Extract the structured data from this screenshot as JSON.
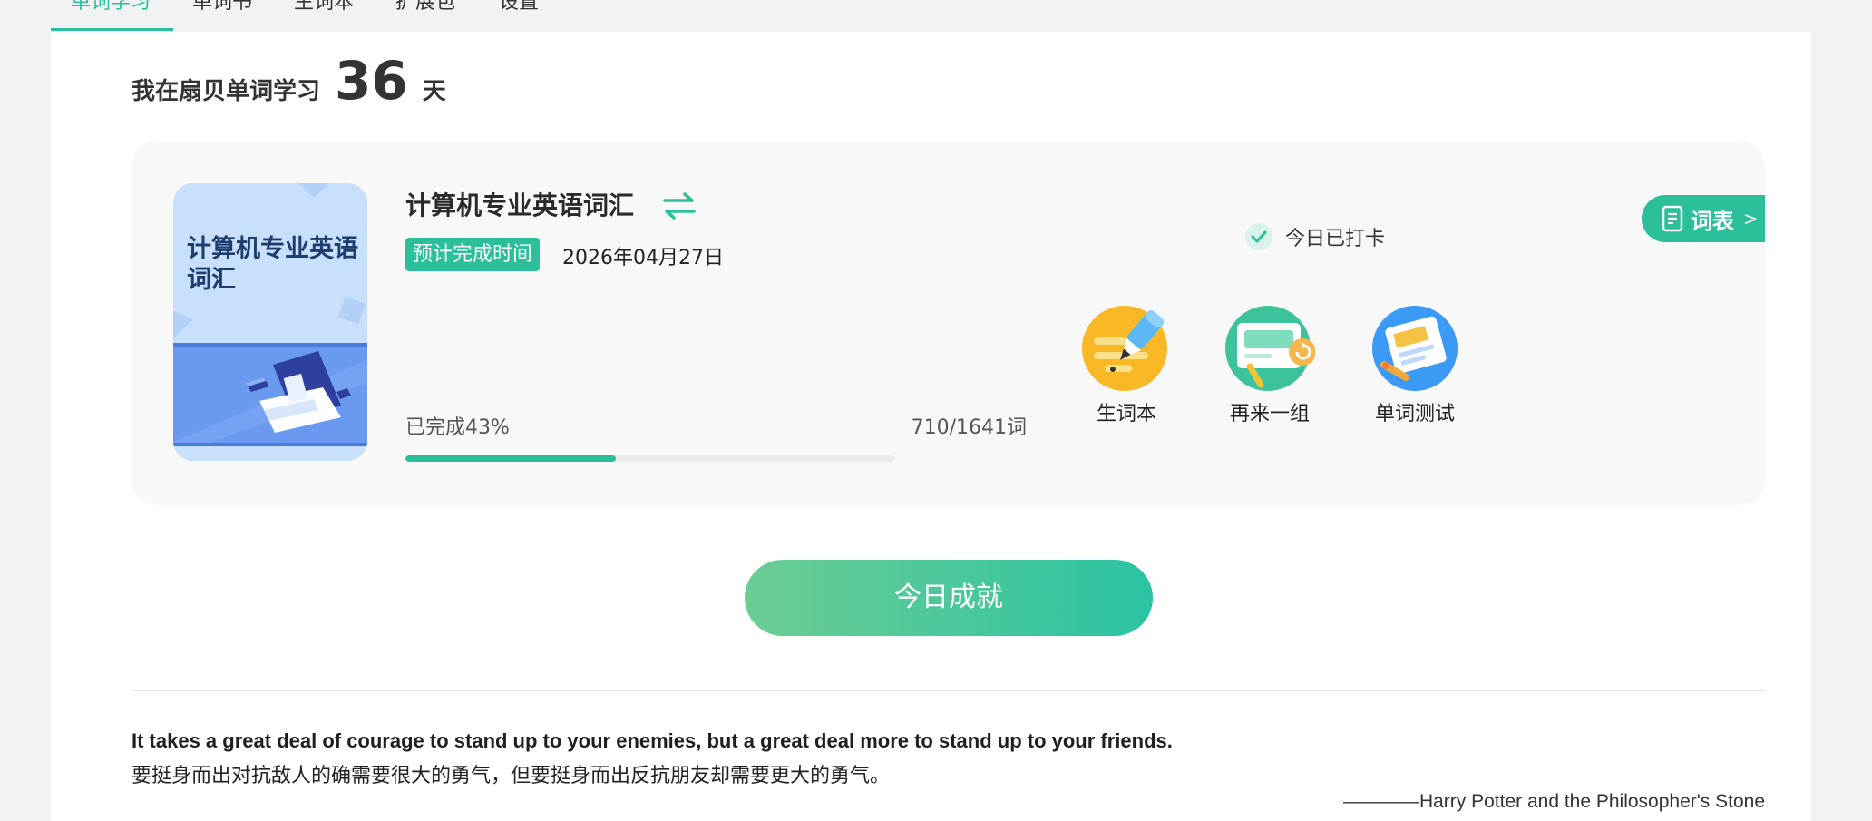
{
  "nav": {
    "tabs": [
      {
        "label": "单词学习",
        "active": true
      },
      {
        "label": "单词书",
        "active": false
      },
      {
        "label": "生词本",
        "active": false
      },
      {
        "label": "扩展包",
        "active": false
      },
      {
        "label": "设置",
        "active": false
      }
    ]
  },
  "streak": {
    "prefix": "我在扇贝单词学习",
    "days": "36",
    "suffix": "天"
  },
  "book": {
    "cover_title": "计算机专业英语词汇",
    "title": "计算机专业英语词汇",
    "eta_label": "预计完成时间",
    "eta_date": "2026年04月27日",
    "progress_label": "已完成43%",
    "progress_fraction": 0.43,
    "count": "710/1641词",
    "switch_icon": "swap-arrows-icon"
  },
  "checkin": {
    "label": "今日已打卡",
    "icon": "check-circle-icon"
  },
  "wordlist_button": {
    "label": "词表",
    "arrow": ">",
    "icon": "document-icon"
  },
  "actions": [
    {
      "label": "生词本",
      "icon": "pen-notebook-icon",
      "color": "#f9b826"
    },
    {
      "label": "再来一组",
      "icon": "card-refresh-icon",
      "color": "#3cc39c"
    },
    {
      "label": "单词测试",
      "icon": "test-paper-icon",
      "color": "#3a9af5"
    }
  ],
  "cta": {
    "label": "今日成就"
  },
  "quote": {
    "en": "It takes a great deal of courage to stand up to your enemies, but a great deal more to stand up to your friends.",
    "zh": "要挺身而出对抗敌人的确需要很大的勇气，但要挺身而出反抗朋友却需要更大的勇气。",
    "source": "————Harry Potter and the Philosopher's Stone"
  },
  "colors": {
    "accent": "#2bbf9a",
    "background": "#f1f2f4",
    "card": "#f8f8f8"
  }
}
